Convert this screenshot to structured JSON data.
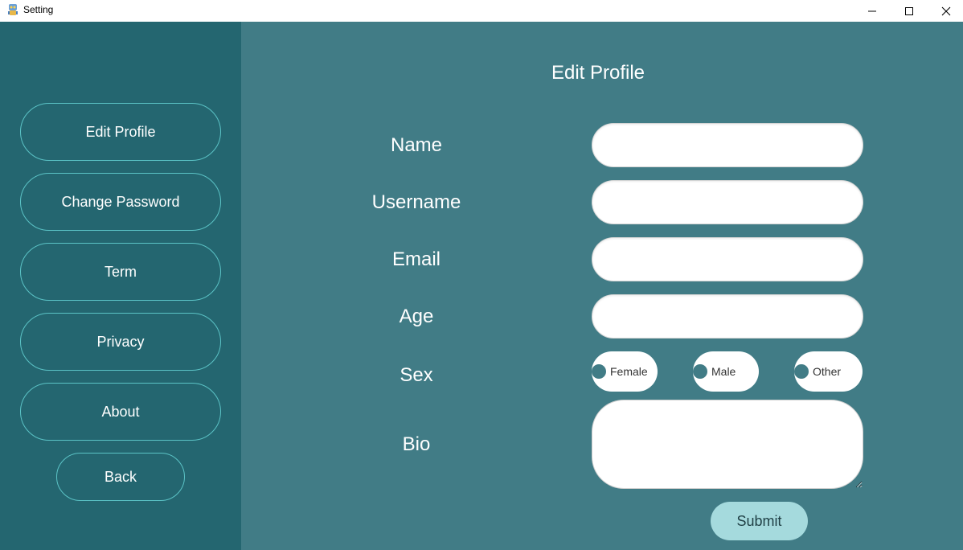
{
  "window": {
    "title": "Setting",
    "icon": "app-icon",
    "controls": {
      "minimize": "minimize-icon",
      "maximize": "maximize-icon",
      "close": "close-icon"
    }
  },
  "sidebar": {
    "items": [
      {
        "label": "Edit Profile"
      },
      {
        "label": "Change Password"
      },
      {
        "label": "Term"
      },
      {
        "label": "Privacy"
      },
      {
        "label": "About"
      }
    ],
    "back_label": "Back"
  },
  "main": {
    "title": "Edit Profile",
    "fields": {
      "name": {
        "label": "Name",
        "value": ""
      },
      "username": {
        "label": "Username",
        "value": ""
      },
      "email": {
        "label": "Email",
        "value": ""
      },
      "age": {
        "label": "Age",
        "value": ""
      },
      "sex": {
        "label": "Sex",
        "options": [
          "Female",
          "Male",
          "Other"
        ]
      },
      "bio": {
        "label": "Bio",
        "value": ""
      }
    },
    "submit_label": "Submit"
  },
  "colors": {
    "sidebar_bg": "#246670",
    "main_bg": "#417c86",
    "button_border": "#5bc3c6",
    "submit_bg": "#a5dadd"
  }
}
